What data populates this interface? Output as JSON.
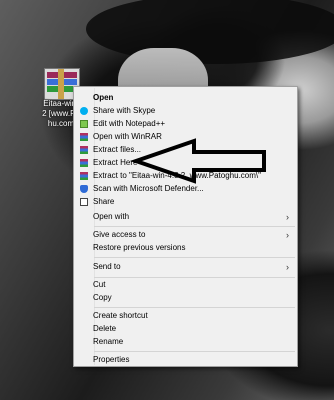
{
  "desktop_icon": {
    "label_lines": [
      "Eitaa-win-",
      "2 [www.Pa",
      "hu.com"
    ],
    "icon": "winrar-archive-icon"
  },
  "context_menu": {
    "items": [
      {
        "label": "Open",
        "bold": true,
        "icon": ""
      },
      {
        "label": "Share with Skype",
        "icon": "skype-icon"
      },
      {
        "label": "Edit with Notepad++",
        "icon": "notepad-plus-plus-icon"
      },
      {
        "label": "Open with WinRAR",
        "icon": "winrar-icon"
      },
      {
        "label": "Extract files...",
        "icon": "winrar-icon"
      },
      {
        "label": "Extract Here",
        "icon": "winrar-icon"
      },
      {
        "label": "Extract to \"Eitaa-win-4.3.2_www.Patoghu.com\\\"",
        "icon": "winrar-icon"
      },
      {
        "label": "Scan with Microsoft Defender...",
        "icon": "defender-shield-icon"
      },
      {
        "label": "Share",
        "icon": "share-icon"
      },
      {
        "label": "Open with",
        "icon": "",
        "submenu": true
      },
      {
        "label": "Give access to",
        "icon": "",
        "submenu": true
      },
      {
        "label": "Restore previous versions",
        "icon": ""
      },
      {
        "label": "Send to",
        "icon": "",
        "submenu": true
      },
      {
        "label": "Cut",
        "icon": ""
      },
      {
        "label": "Copy",
        "icon": ""
      },
      {
        "label": "Create shortcut",
        "icon": ""
      },
      {
        "label": "Delete",
        "icon": ""
      },
      {
        "label": "Rename",
        "icon": ""
      },
      {
        "label": "Properties",
        "icon": ""
      }
    ]
  },
  "annotation": {
    "type": "arrow-pointing-left",
    "target": "Extract Here",
    "color": "#000000"
  }
}
